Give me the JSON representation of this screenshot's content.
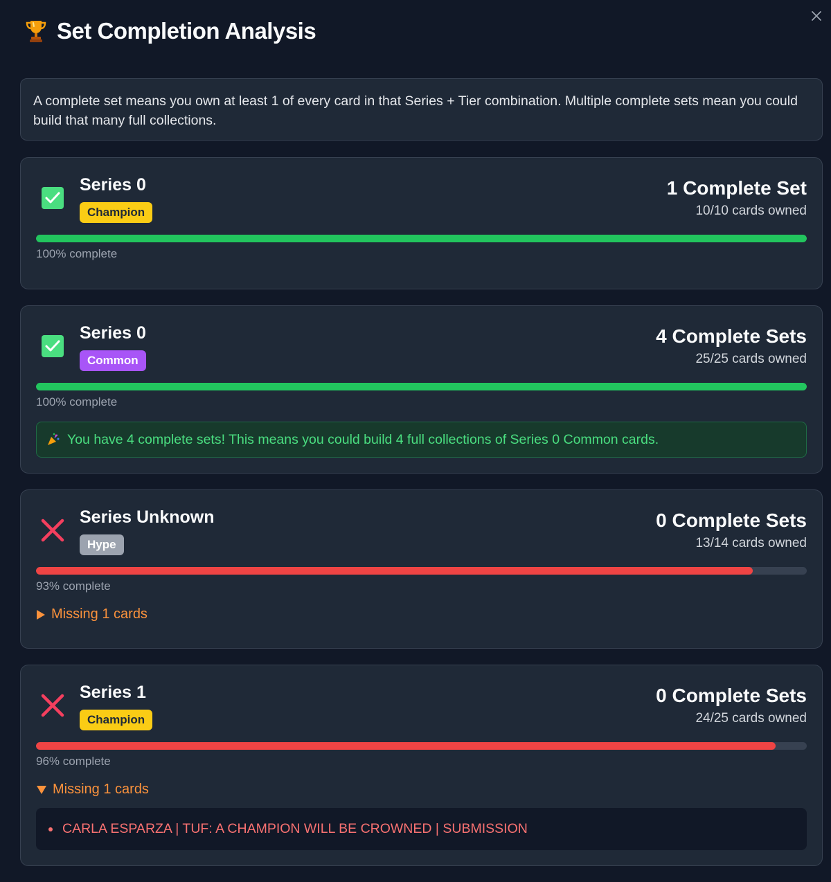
{
  "header": {
    "title": "Set Completion Analysis",
    "icon": "trophy-icon"
  },
  "info": {
    "text": "A complete set means you own at least 1 of every card in that Series + Tier combination. Multiple complete sets mean you could build that many full collections."
  },
  "colors": {
    "complete": "#22c55e",
    "incomplete": "#ef4444",
    "champion": "#facc15",
    "common": "#a855f7",
    "hype": "#9ca3af",
    "missing": "#fb923c"
  },
  "cards": [
    {
      "series": "Series 0",
      "tier": "Champion",
      "status": "complete",
      "sets": "1 Complete Set",
      "owned": "10/10 cards owned",
      "progress": 1.0,
      "percent_text": "100% complete"
    },
    {
      "series": "Series 0",
      "tier": "Common",
      "status": "complete",
      "sets": "4 Complete Sets",
      "owned": "25/25 cards owned",
      "progress": 1.0,
      "percent_text": "100% complete",
      "celebration": "You have 4 complete sets! This means you could build 4 full collections of Series 0 Common cards."
    },
    {
      "series": "Series Unknown",
      "tier": "Hype",
      "status": "incomplete",
      "sets": "0 Complete Sets",
      "owned": "13/14 cards owned",
      "progress": 0.93,
      "percent_text": "93% complete",
      "missing_label": "Missing 1 cards",
      "expanded": false
    },
    {
      "series": "Series 1",
      "tier": "Champion",
      "status": "incomplete",
      "sets": "0 Complete Sets",
      "owned": "24/25 cards owned",
      "progress": 0.96,
      "percent_text": "96% complete",
      "missing_label": "Missing 1 cards",
      "expanded": true,
      "missing_items": [
        "CARLA ESPARZA | TUF: A CHAMPION WILL BE CROWNED | SUBMISSION"
      ]
    }
  ]
}
